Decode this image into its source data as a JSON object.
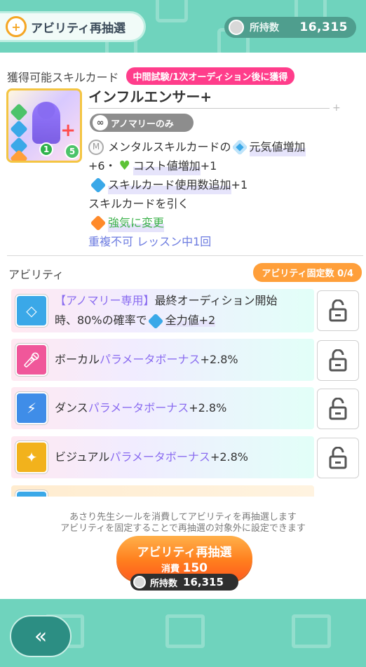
{
  "header": {
    "title": "アビリティ再抽選",
    "currency_label": "所持数",
    "currency_value": "16,315"
  },
  "skill_section": {
    "title": "獲得可能スキルカード",
    "timing_badge": "中間試験/1次オーディション後に獲得",
    "card_name": "インフルエンサー+",
    "tag": "アノマリーのみ",
    "effects": {
      "line1_a": "メンタルスキルカードの",
      "line1_b": "元気値増加",
      "line2_a": "+6・",
      "line2_b": "コスト値増加",
      "line2_c": "+1",
      "line3_a": "スキルカード使用数追加",
      "line3_b": "+1",
      "line4": "スキルカードを引く",
      "line5": "強気に変更",
      "line6": "重複不可 レッスン中1回"
    },
    "thumb": {
      "num1": "1",
      "num5": "5"
    }
  },
  "ability_section": {
    "title": "アビリティ",
    "fixed_badge": "アビリティ固定数 0/4",
    "abilities": [
      {
        "prefix": "【アノマリー専用】",
        "text_a": "最終オーディション開始",
        "text_b": "時、80%の確率で",
        "text_c": "全力値+2",
        "icon": "anomaly-icon",
        "color": "#3aa8e8"
      },
      {
        "text_a": "ボーカル",
        "text_b": "パラメータボーナス",
        "text_c": "+2.8%",
        "icon": "microphone-icon",
        "color": "#f0579a"
      },
      {
        "text_a": "ダンス",
        "text_b": "パラメータボーナス",
        "text_c": "+2.8%",
        "icon": "shoe-icon",
        "color": "#3f8de8"
      },
      {
        "text_a": "ビジュアル",
        "text_b": "パラメータボーナス",
        "text_c": "+2.8%",
        "icon": "visual-icon",
        "color": "#f2b21c"
      }
    ]
  },
  "footer": {
    "note_line1": "あさり先生シールを消費してアビリティを再抽選します",
    "note_line2": "アビリティを固定することで再抽選の対象外に設定できます",
    "reroll_label": "アビリティ再抽選",
    "cost_label": "消費",
    "cost_value": "150",
    "owned_label": "所持数",
    "owned_value": "16,315",
    "back_label": "«"
  },
  "colors": {
    "accent_teal": "#6fd3bd",
    "badge_pink": "#ff3d8b",
    "badge_orange": "#ff9f3a",
    "button_orange": "#ff7f1e"
  }
}
